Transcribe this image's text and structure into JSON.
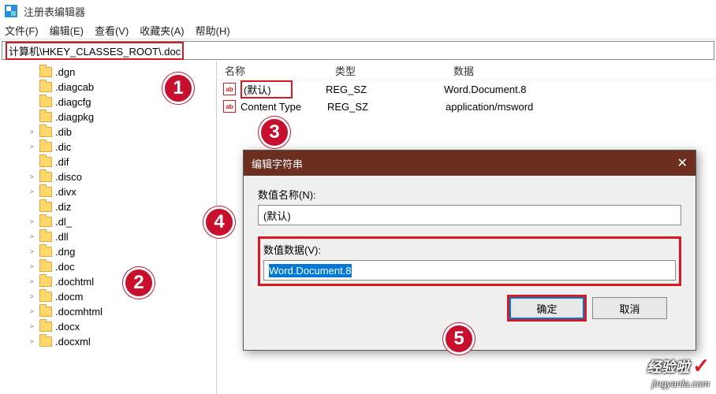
{
  "window": {
    "title": "注册表编辑器"
  },
  "menu": {
    "file": "文件(F)",
    "edit": "编辑(E)",
    "view": "查看(V)",
    "fav": "收藏夹(A)",
    "help": "帮助(H)"
  },
  "address": "计算机\\HKEY_CLASSES_ROOT\\.doc",
  "tree": {
    "items": [
      ".dgn",
      ".diagcab",
      ".diagcfg",
      ".diagpkg",
      ".dib",
      ".dic",
      ".dif",
      ".disco",
      ".divx",
      ".diz",
      ".dl_",
      ".dll",
      ".dng",
      ".doc",
      ".dochtml",
      ".docm",
      ".docmhtml",
      ".docx",
      ".docxml"
    ],
    "expandable": [
      ".dib",
      ".dic",
      ".disco",
      ".divx",
      ".dl_",
      ".dll",
      ".dng",
      ".doc",
      ".dochtml",
      ".docm",
      ".docmhtml",
      ".docx",
      ".docxml"
    ],
    "selected": ".doc"
  },
  "list": {
    "headers": {
      "name": "名称",
      "type": "类型",
      "data": "数据"
    },
    "rows": [
      {
        "name": "(默认)",
        "type": "REG_SZ",
        "data": "Word.Document.8",
        "highlight": true
      },
      {
        "name": "Content Type",
        "type": "REG_SZ",
        "data": "application/msword",
        "highlight": false
      }
    ]
  },
  "dialog": {
    "title": "编辑字符串",
    "name_label": "数值名称(N):",
    "name_value": "(默认)",
    "data_label": "数值数据(V):",
    "data_value": "Word.Document.8",
    "ok": "确定",
    "cancel": "取消"
  },
  "badges": {
    "b1": "1",
    "b2": "2",
    "b3": "3",
    "b4": "4",
    "b5": "5"
  },
  "watermark": {
    "text": "经验啦",
    "url": "jingyanla.com"
  }
}
